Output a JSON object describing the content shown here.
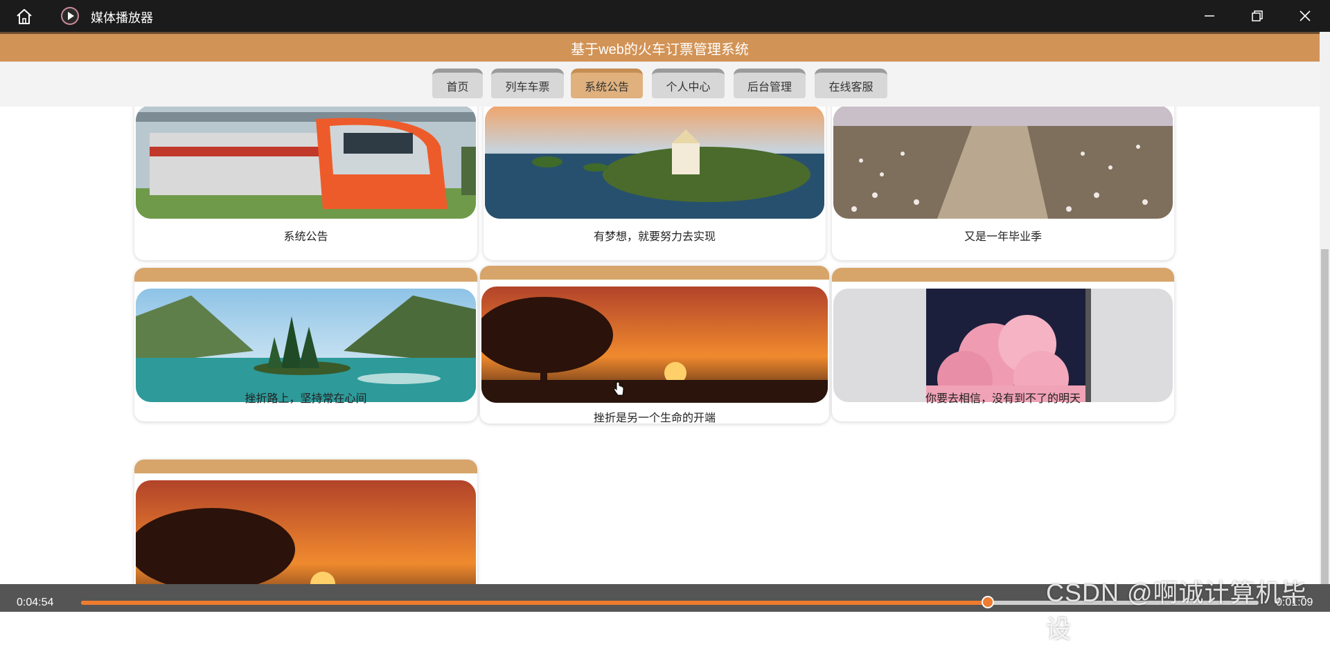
{
  "player": {
    "title": "媒体播放器",
    "time_elapsed": "0:04:54",
    "time_remaining": "0:01:09",
    "progress": 0.77,
    "watermark": "CSDN @啊诚计算机毕设"
  },
  "site": {
    "title": "基于web的火车订票管理系统"
  },
  "nav": {
    "items": [
      {
        "label": "首页"
      },
      {
        "label": "列车车票"
      },
      {
        "label": "系统公告"
      },
      {
        "label": "个人中心"
      },
      {
        "label": "后台管理"
      },
      {
        "label": "在线客服"
      }
    ],
    "active": "系统公告"
  },
  "cards": [
    {
      "caption": "系统公告",
      "image": "red-train"
    },
    {
      "caption": "有梦想，就要努力去实现",
      "image": "island-church-sunset"
    },
    {
      "caption": "又是一年毕业季",
      "image": "dandelion-path"
    },
    {
      "caption": "挫折路上，坚持常在心间",
      "image": "mountain-lake"
    },
    {
      "caption": "挫折是另一个生命的开端",
      "image": "sunset-tree"
    },
    {
      "caption": "你要去相信，没有到不了的明天",
      "image": "pink-cloud-night"
    },
    {
      "caption": "",
      "image": "sunset-tree"
    }
  ],
  "colors": {
    "accent": "#d29356",
    "card_top": "#d7a56a",
    "active_tab": "#e0b17d",
    "progress": "#ef7b2f"
  }
}
